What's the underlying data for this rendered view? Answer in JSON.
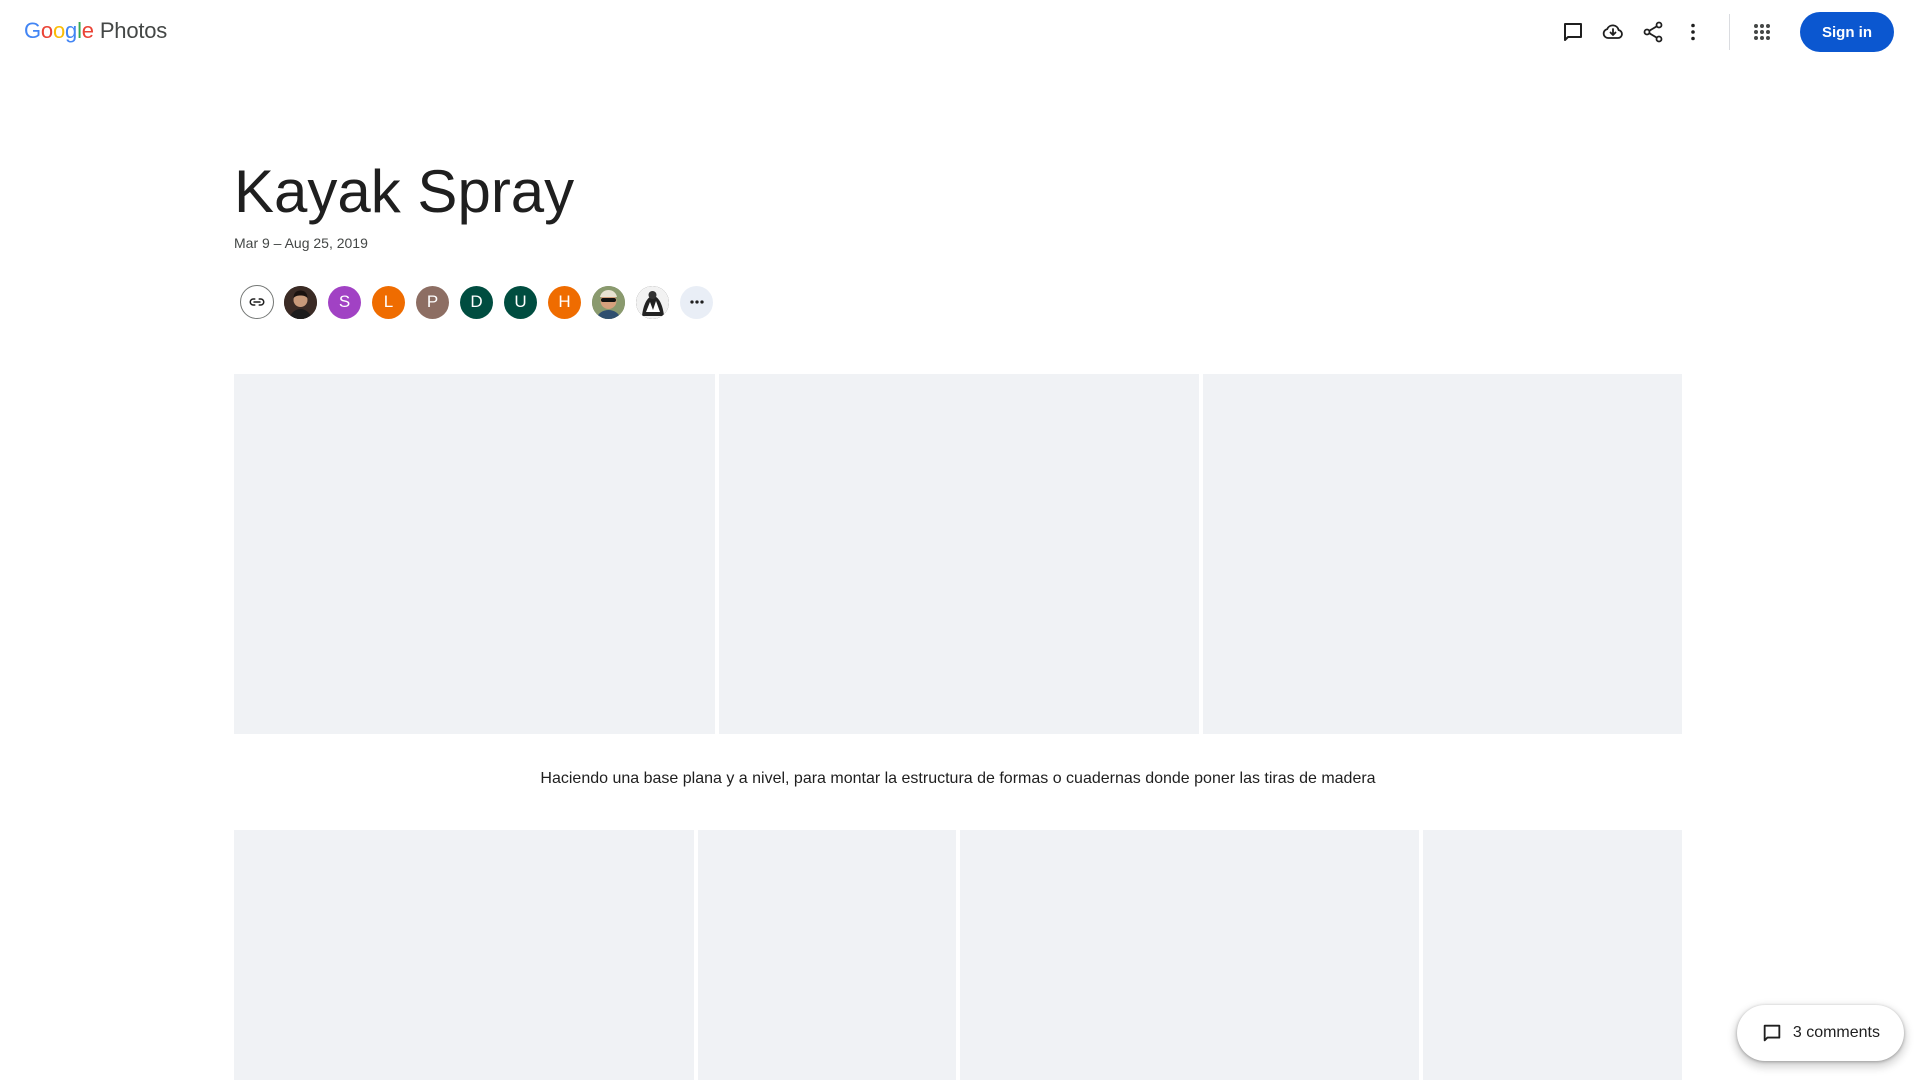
{
  "header": {
    "logo": {
      "letters": [
        "G",
        "o",
        "o",
        "g",
        "l",
        "e"
      ],
      "product": "Photos"
    },
    "icons": [
      "comment-icon",
      "download-icon",
      "share-icon",
      "more-vert-icon",
      "apps-icon"
    ],
    "signin_label": "Sign in"
  },
  "album": {
    "title": "Kayak Spray",
    "date_range": "Mar 9 – Aug 25, 2019",
    "caption": "Haciendo una base plana y a nivel, para montar la estructura de formas o cuadernas donde poner las tiras de madera"
  },
  "people": {
    "link_icon": "link-icon",
    "avatars": [
      {
        "type": "photo",
        "color": "#3b2b25"
      },
      {
        "type": "letter",
        "letter": "S",
        "color": "#a142c4"
      },
      {
        "type": "letter",
        "letter": "L",
        "color": "#ef6c00"
      },
      {
        "type": "letter",
        "letter": "P",
        "color": "#8d6e63"
      },
      {
        "type": "letter",
        "letter": "D",
        "color": "#004d40"
      },
      {
        "type": "letter",
        "letter": "U",
        "color": "#004d40"
      },
      {
        "type": "letter",
        "letter": "H",
        "color": "#ef6c00"
      },
      {
        "type": "photo",
        "color": "#6b7a5a"
      },
      {
        "type": "photo",
        "color": "#2a2a2a"
      }
    ],
    "more_icon": "more-horiz-icon"
  },
  "comments": {
    "label": "3 comments"
  },
  "colors": {
    "accent": "#0b57d0",
    "tile_placeholder": "#f0f2f5"
  }
}
